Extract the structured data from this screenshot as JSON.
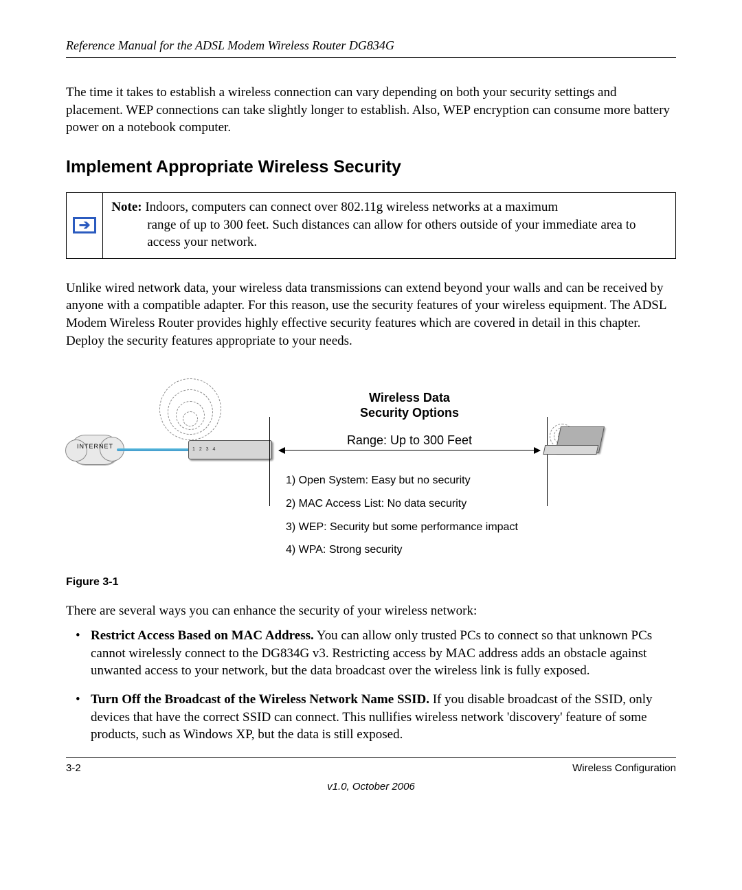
{
  "header": {
    "title": "Reference Manual for the ADSL Modem Wireless Router DG834G"
  },
  "intro_para": "The time it takes to establish a wireless connection can vary depending on both your security settings and placement. WEP connections can take slightly longer to establish. Also, WEP encryption can consume more battery power on a notebook computer.",
  "section_title": "Implement Appropriate Wireless Security",
  "note": {
    "label": "Note:",
    "line1": " Indoors, computers can connect over 802.11g wireless networks at a maximum ",
    "rest": "range of up to 300 feet. Such distances can allow for others outside of your immediate area to access your network."
  },
  "para2": "Unlike wired network data, your wireless data transmissions can extend beyond your walls and can be received by anyone with a compatible adapter. For this reason, use the security features of your wireless equipment. The ADSL Modem Wireless Router provides highly effective security features which are covered in detail in this chapter. Deploy the security features appropriate to your needs.",
  "figure": {
    "internet_label": "INTERNET",
    "router_text": "1  2  3  4",
    "title_l1": "Wireless Data",
    "title_l2": "Security Options",
    "range": "Range: Up to 300 Feet",
    "options": [
      "1) Open System:  Easy but no security",
      "2) MAC Access List:  No data security",
      "3) WEP:  Security but some performance impact",
      "4) WPA:  Strong security"
    ],
    "caption": "Figure 3-1"
  },
  "lead_sentence": "There are several ways you can enhance the security of your wireless network:",
  "bullets": [
    {
      "bold": "Restrict Access Based on MAC Address.",
      "text": " You can allow only trusted PCs to connect so that unknown PCs cannot wirelessly connect to the DG834G v3. Restricting access by MAC address adds an obstacle against unwanted access to your network, but the data broadcast over the wireless link is fully exposed."
    },
    {
      "bold": "Turn Off the Broadcast of the Wireless Network Name SSID.",
      "text": " If you disable broadcast of the SSID, only devices that have the correct SSID can connect. This nullifies wireless network 'discovery' feature of some products, such as Windows XP, but the data is still exposed."
    }
  ],
  "footer": {
    "left": "3-2",
    "right": "Wireless Configuration",
    "version": "v1.0, October 2006"
  },
  "chart_data": {
    "type": "table",
    "title": "Wireless Data Security Options",
    "range_label": "Range: Up to 300 Feet",
    "rows": [
      {
        "n": 1,
        "option": "Open System",
        "note": "Easy but no security"
      },
      {
        "n": 2,
        "option": "MAC Access List",
        "note": "No data security"
      },
      {
        "n": 3,
        "option": "WEP",
        "note": "Security but some performance impact"
      },
      {
        "n": 4,
        "option": "WPA",
        "note": "Strong security"
      }
    ]
  }
}
